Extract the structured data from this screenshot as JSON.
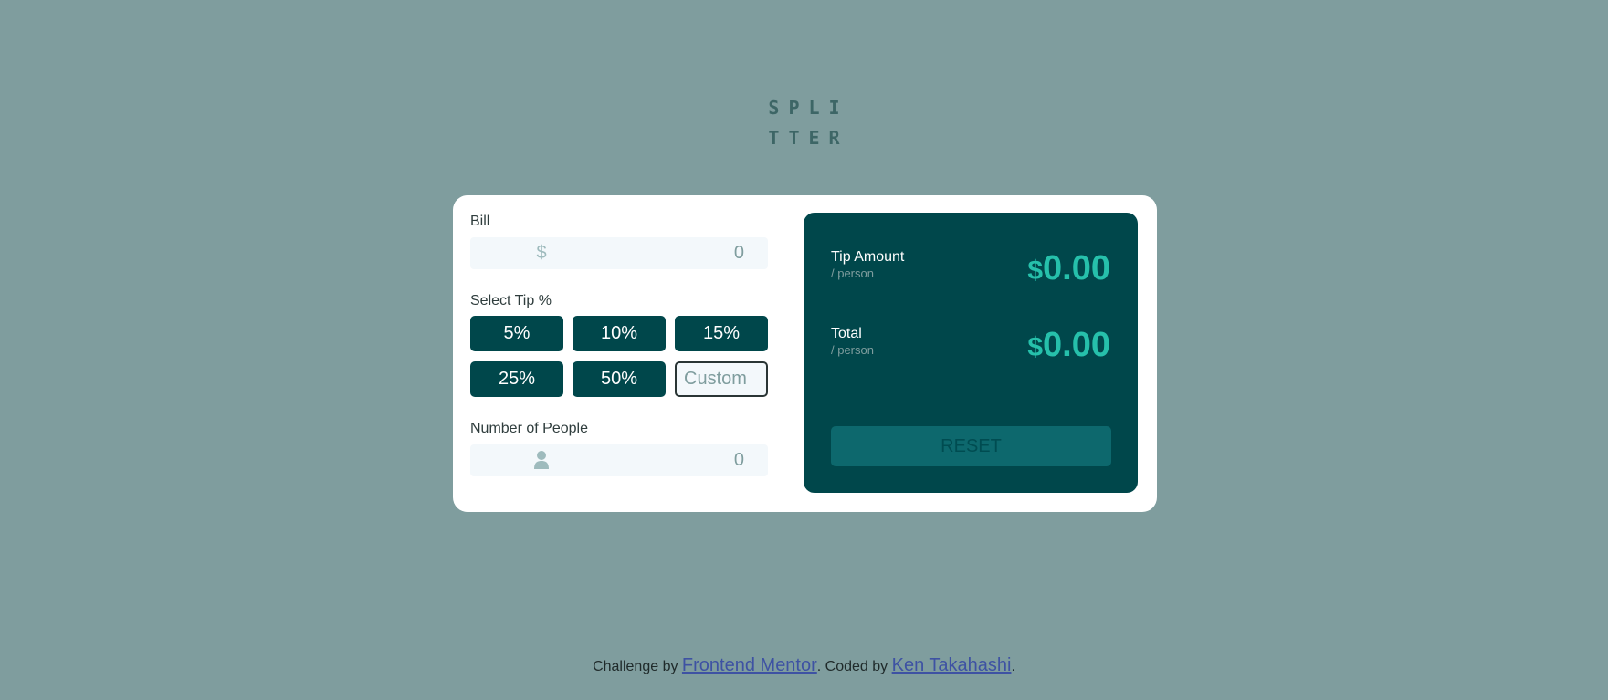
{
  "logo": {
    "line1": "SPLI",
    "line2": "TTER"
  },
  "bill": {
    "label": "Bill",
    "icon": "dollar-icon",
    "icon_glyph": "$",
    "value": "0"
  },
  "tip": {
    "label": "Select Tip %",
    "options": [
      "5%",
      "10%",
      "15%",
      "25%",
      "50%"
    ],
    "custom_placeholder": "Custom"
  },
  "people": {
    "label": "Number of People",
    "icon": "person-icon",
    "value": "0"
  },
  "results": {
    "tip_amount": {
      "label": "Tip Amount",
      "sub": "/ person",
      "currency": "$",
      "value": "0.00"
    },
    "total": {
      "label": "Total",
      "sub": "/ person",
      "currency": "$",
      "value": "0.00"
    },
    "reset_label": "RESET"
  },
  "footer": {
    "prefix": "Challenge by",
    "link1": "Frontend Mentor",
    "middle": ". Coded by",
    "link2": "Ken Takahashi",
    "suffix": "."
  },
  "colors": {
    "background": "#7f9d9e",
    "dark_cyan": "#00474b",
    "accent": "#26c0ab",
    "card": "#ffffff"
  }
}
